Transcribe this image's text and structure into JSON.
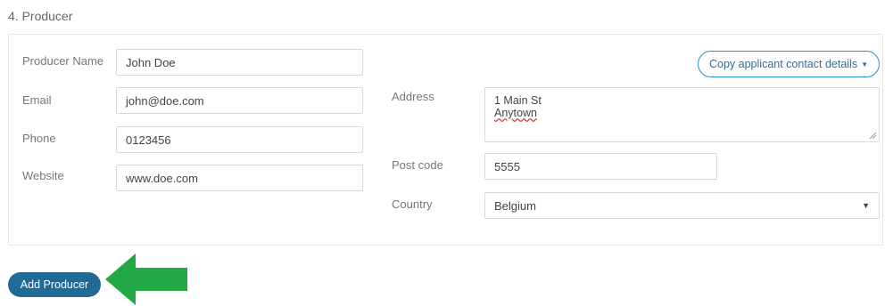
{
  "section": {
    "title": "4. Producer"
  },
  "producer": {
    "name_label": "Producer Name",
    "name_value": "John Doe",
    "email_label": "Email",
    "email_value": "john@doe.com",
    "phone_label": "Phone",
    "phone_value": "0123456",
    "website_label": "Website",
    "website_value": "www.doe.com",
    "address_label": "Address",
    "address_line1": "1 Main St",
    "address_line2": "Anytown",
    "postcode_label": "Post code",
    "postcode_value": "5555",
    "country_label": "Country",
    "country_value": "Belgium"
  },
  "actions": {
    "copy_label": "Copy applicant contact details",
    "add_label": "Add Producer"
  },
  "colors": {
    "primary": "#226a96",
    "outline": "#2a8fc4",
    "arrow": "#22a845"
  },
  "icons": {
    "caret": "caret-down-icon",
    "arrow": "arrow-left-icon",
    "grip": "resize-grip-icon"
  }
}
